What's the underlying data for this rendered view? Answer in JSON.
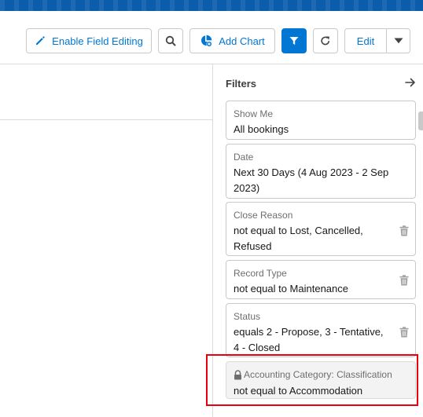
{
  "toolbar": {
    "enable_field_editing": "Enable Field Editing",
    "add_chart": "Add Chart",
    "edit": "Edit"
  },
  "filters": {
    "title": "Filters",
    "cards": [
      {
        "label": "Show Me",
        "value": "All bookings",
        "deletable": false,
        "locked": false
      },
      {
        "label": "Date",
        "value": "Next 30 Days (4 Aug 2023 - 2 Sep 2023)",
        "deletable": false,
        "locked": false
      },
      {
        "label": "Close Reason",
        "value": "not equal to Lost, Cancelled, Refused",
        "deletable": true,
        "locked": false
      },
      {
        "label": "Record Type",
        "value": "not equal to Maintenance",
        "deletable": true,
        "locked": false
      },
      {
        "label": "Status",
        "value": "equals 2 - Propose, 3 - Tentative, 4 - Closed",
        "deletable": true,
        "locked": false
      },
      {
        "label": "Accounting Category: Classification",
        "value": "not equal to Accommodation",
        "deletable": false,
        "locked": true
      }
    ]
  },
  "colors": {
    "brand": "#0176d3",
    "banner": "#0b5cab",
    "highlight": "#e8000b"
  },
  "icons": {
    "edit": "pencil-icon",
    "search": "search-icon",
    "chart": "chart-icon",
    "filter": "filter-icon",
    "refresh": "refresh-icon",
    "dropdown": "chevron-down-icon",
    "collapse": "arrow-right-icon",
    "delete": "trash-icon",
    "lock": "lock-icon"
  }
}
